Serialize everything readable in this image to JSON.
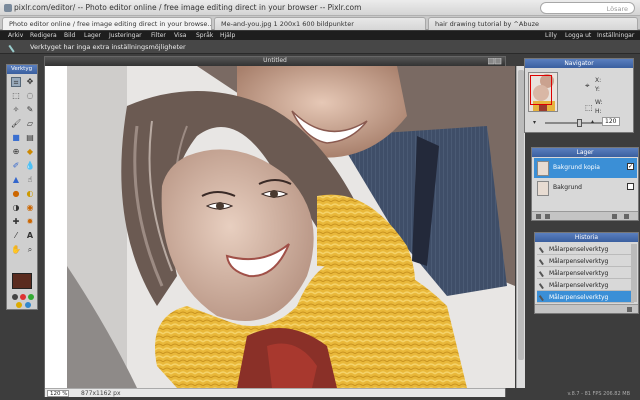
{
  "browser": {
    "url": "pixlr.com/editor/ -- Photo editor online / free image editing direct in your browser -- Pixlr.com",
    "search_placeholder": "Lösare",
    "tabs": [
      "Photo editor online / free image editing direct in your browse...",
      "Me-and-you.jpg 1 200x1 600 bildpunkter",
      "hair drawing tutorial by ^Abuze"
    ]
  },
  "menu": {
    "items": [
      "Arkiv",
      "Redigera",
      "Bild",
      "Lager",
      "Justeringar",
      "Filter",
      "Visa",
      "Språk",
      "Hjälp"
    ],
    "right": [
      "Lilly",
      "Logga ut",
      "Inställningar"
    ]
  },
  "options_bar": {
    "hint": "Verktyget har inga extra inställningsmöjligheter"
  },
  "toolbox": {
    "title": "Verktyg"
  },
  "canvas": {
    "title": "Untitled",
    "zoom": "120",
    "zoom_unit": "%",
    "dimensions": "877x1162 px"
  },
  "navigator": {
    "title": "Navigator",
    "x_label": "X:",
    "y_label": "Y:",
    "w_label": "W:",
    "h_label": "H:",
    "zoom": "120",
    "zoom_level": 0.55
  },
  "layers": {
    "title": "Lager",
    "items": [
      {
        "name": "Bakgrund kopia",
        "active": true,
        "checked": true
      },
      {
        "name": "Bakgrund",
        "active": false,
        "checked": false
      }
    ]
  },
  "history": {
    "title": "Historia",
    "items": [
      "Målarpenselverktyg",
      "Målarpenselverktyg",
      "Målarpenselverktyg",
      "Målarpenselverktyg",
      "Målarpenselverktyg"
    ],
    "active_index": 4
  },
  "footer": {
    "version": "v.8.7 - 81 FPS 206.82 MB"
  },
  "colors": {
    "accent": "#3b8fd6",
    "foreground": "#5a2b1f",
    "menubar": "#1e1e1e"
  }
}
